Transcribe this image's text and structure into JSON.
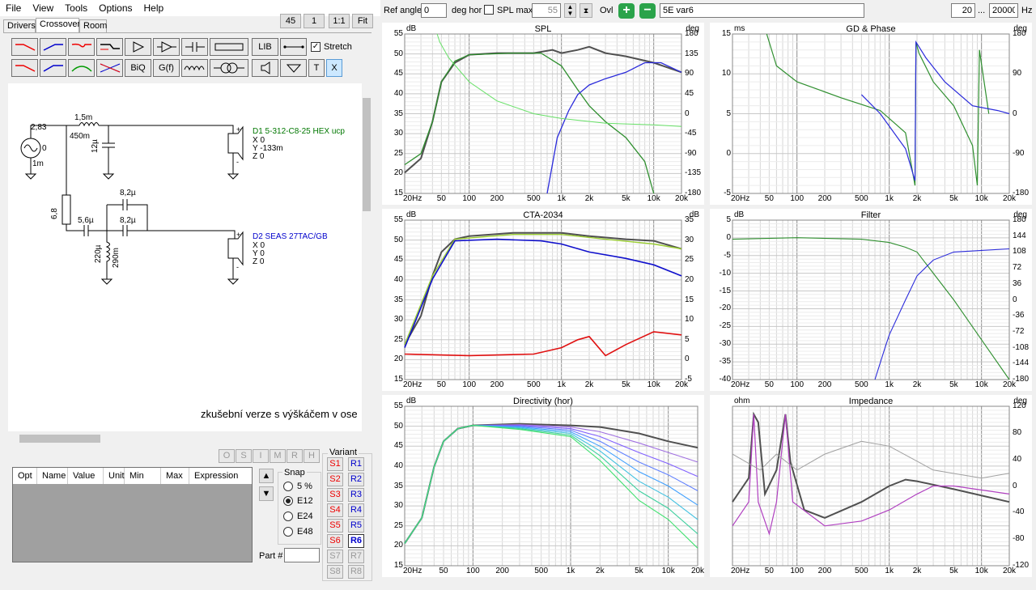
{
  "menu": [
    "File",
    "View",
    "Tools",
    "Options",
    "Help"
  ],
  "top_buttons": {
    "b45": "45",
    "b1": "1",
    "b11": "1:1",
    "fit": "Fit"
  },
  "tabs": [
    "Drivers",
    "Crossover",
    "Room"
  ],
  "toolbar": {
    "lib": "LIB",
    "stretch": "Stretch",
    "biq": "BiQ",
    "gf": "G(f)",
    "t": "T",
    "x": "X"
  },
  "header": {
    "ref_angle_label": "Ref angle",
    "ref_angle_value": "0",
    "deg_hor": "deg hor",
    "spl_max_label": "SPL max",
    "spl_max_value": "55",
    "ovl_label": "Ovl",
    "project_name": "5E var6",
    "freq_min": "20",
    "freq_sep": "...",
    "freq_max": "20000",
    "hz": "Hz"
  },
  "schematic": {
    "src_v": "2,83",
    "src_phase": "0",
    "src_r": "1m",
    "l1_val": "1,5m",
    "l1_r": "450m",
    "c1_val": "12µ",
    "r1_val": "6,8",
    "c2_val": "5,6µ",
    "c3_val": "8,2µ",
    "c4_val": "8,2µ",
    "l2_val": "220µ",
    "l2_r": "290m",
    "d1_name": "D1 5-312-C8-25 HEX ucp",
    "d1_x": "X 0",
    "d1_y": "Y -133m",
    "d1_z": "Z 0",
    "d2_name": "D2 SEAS 27TAC/GB",
    "d2_x": "X 0",
    "d2_y": "Y 0",
    "d2_z": "Z 0",
    "note": "zkušební verze s výškáčem v ose"
  },
  "osim": [
    "O",
    "S",
    "I",
    "M",
    "R",
    "H"
  ],
  "table_headers": [
    "Opt",
    "Name",
    "Value",
    "Unit",
    "Min",
    "Max",
    "Expression"
  ],
  "snap": {
    "title": "Snap",
    "options": [
      "5 %",
      "E12",
      "E24",
      "E48"
    ],
    "selected": "E12"
  },
  "part_label": "Part #",
  "variant": {
    "title": "Variant",
    "s": [
      "S1",
      "S2",
      "S3",
      "S4",
      "S5",
      "S6",
      "S7",
      "S8"
    ],
    "r": [
      "R1",
      "R2",
      "R3",
      "R4",
      "R5",
      "R6",
      "R7",
      "R8"
    ],
    "active": "R6"
  },
  "plots": {
    "spl": {
      "title": "SPL",
      "ul": "dB",
      "ur": "deg",
      "left": [
        "55",
        "50",
        "45",
        "40",
        "35",
        "30",
        "25",
        "20",
        "15"
      ],
      "right": [
        "180",
        "135",
        "90",
        "45",
        "0",
        "-45",
        "-90",
        "-135",
        "-180"
      ]
    },
    "gd": {
      "title": "GD & Phase",
      "ul": "ms",
      "ur": "deg",
      "left": [
        "15",
        "10",
        "5",
        "0",
        "-5"
      ],
      "right": [
        "180",
        "90",
        "0",
        "-90",
        "-180"
      ]
    },
    "cta": {
      "title": "CTA-2034",
      "ul": "dB",
      "ur": "dB",
      "left": [
        "55",
        "50",
        "45",
        "40",
        "35",
        "30",
        "25",
        "20",
        "15"
      ],
      "right": [
        "35",
        "30",
        "25",
        "20",
        "15",
        "10",
        "5",
        "0",
        "-5"
      ]
    },
    "filter": {
      "title": "Filter",
      "ul": "dB",
      "ur": "deg",
      "left": [
        "5",
        "0",
        "-5",
        "-10",
        "-15",
        "-20",
        "-25",
        "-30",
        "-35",
        "-40"
      ],
      "right": [
        "180",
        "144",
        "108",
        "72",
        "36",
        "0",
        "-36",
        "-72",
        "-108",
        "-144",
        "-180"
      ]
    },
    "dir": {
      "title": "Directivity (hor)",
      "ul": "dB",
      "left": [
        "55",
        "50",
        "45",
        "40",
        "35",
        "30",
        "25",
        "20",
        "15"
      ]
    },
    "imp": {
      "title": "Impedance",
      "ul": "ohm",
      "ur": "deg",
      "left": [
        "",
        "",
        "",
        "",
        "",
        "",
        "",
        "",
        ""
      ],
      "right": [
        "120",
        "80",
        "40",
        "0",
        "-40",
        "-80",
        "-120"
      ]
    },
    "x_ticks": [
      "20Hz",
      "50",
      "100",
      "200",
      "500",
      "1k",
      "2k",
      "5k",
      "10k",
      "20k"
    ]
  }
}
